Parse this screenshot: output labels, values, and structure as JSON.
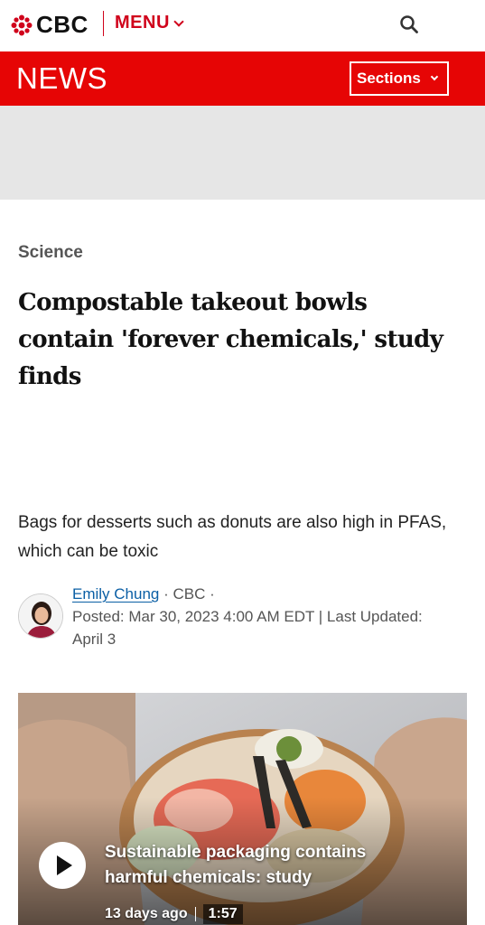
{
  "header": {
    "logo_text": "CBC",
    "menu_label": "MENU",
    "brand_color": "#d0021b"
  },
  "news_bar": {
    "title": "NEWS",
    "sections_label": "Sections",
    "bar_color": "#e60505"
  },
  "article": {
    "category": "Science",
    "headline": "Compostable takeout bowls contain 'forever chemicals,' study finds",
    "deck": "Bags for desserts such as donuts are also high in PFAS, which can be toxic",
    "author": "Emily Chung",
    "source": " · CBC · ",
    "dates": "Posted: Mar 30, 2023 4:00 AM EDT | Last Updated: April 3"
  },
  "media": {
    "title": "Sustainable packaging contains harmful chemicals: study",
    "age": "13 days ago",
    "duration": "1:57"
  },
  "icons": {
    "logo": "cbc-gem-icon",
    "menu_chevron": "chevron-down-icon",
    "search": "search-icon",
    "play": "play-icon"
  }
}
